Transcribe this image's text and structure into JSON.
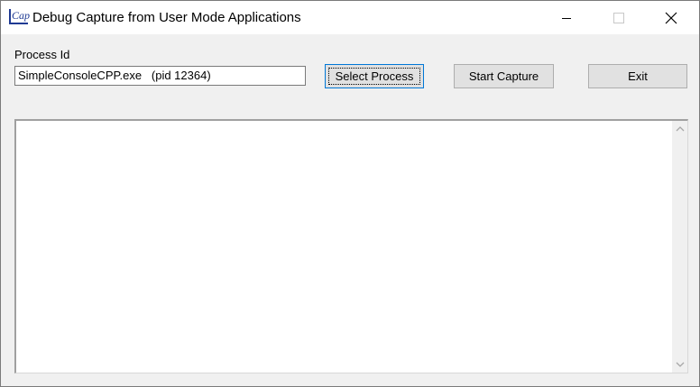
{
  "window": {
    "title": "Debug Capture from User Mode Applications",
    "icon_text": "Cap",
    "icon": "app-cap-icon",
    "controls": [
      "minimize-icon",
      "maximize-icon",
      "close-icon"
    ]
  },
  "form": {
    "process_label": "Process Id",
    "process_value": "SimpleConsoleCPP.exe   (pid 12364)",
    "select_button": "Select Process",
    "start_button": "Start Capture",
    "exit_button": "Exit"
  },
  "output": {
    "text": ""
  },
  "colors": {
    "accent": "#0078d7",
    "icon": "#1f3a93",
    "face": "#f0f0f0"
  }
}
